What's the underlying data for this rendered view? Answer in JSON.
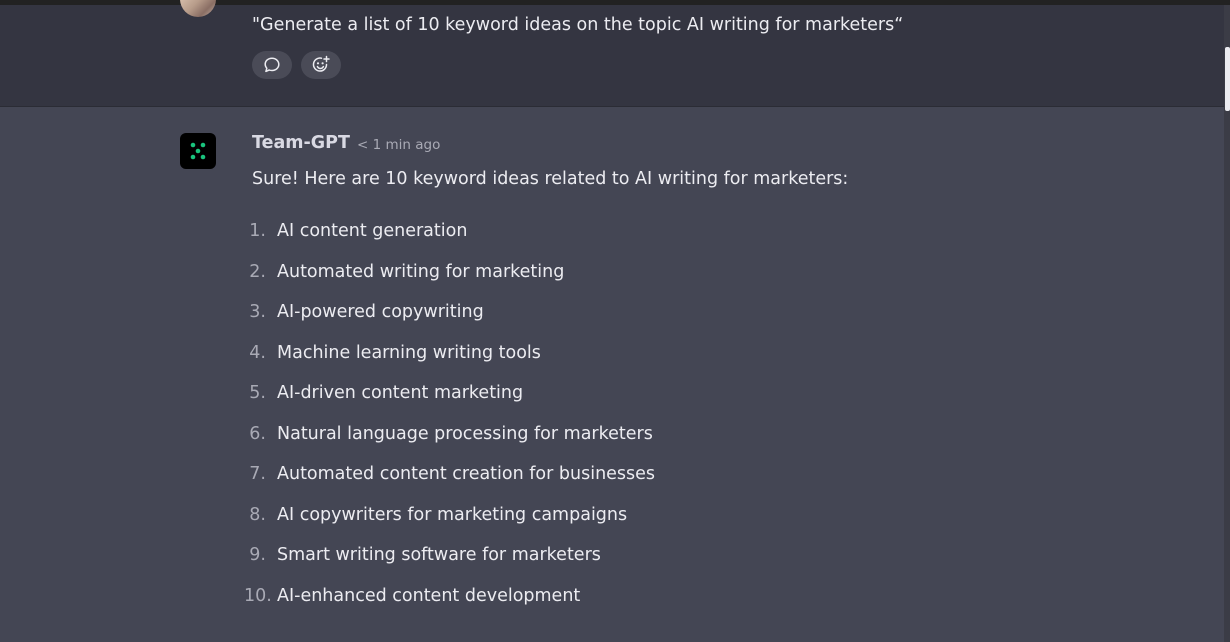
{
  "user_message": {
    "text": "\"Generate a list of 10 keyword ideas on the topic AI writing for marketers“",
    "actions": [
      {
        "icon": "comment-icon"
      },
      {
        "icon": "add-reaction-icon"
      }
    ]
  },
  "assistant_message": {
    "author": "Team-GPT",
    "timestamp": "< 1 min ago",
    "intro": "Sure! Here are 10 keyword ideas related to AI writing for marketers:",
    "keywords": [
      {
        "num": "1.",
        "text": "AI content generation"
      },
      {
        "num": "2.",
        "text": "Automated writing for marketing"
      },
      {
        "num": "3.",
        "text": "AI-powered copywriting"
      },
      {
        "num": "4.",
        "text": "Machine learning writing tools"
      },
      {
        "num": "5.",
        "text": "AI-driven content marketing"
      },
      {
        "num": "6.",
        "text": "Natural language processing for marketers"
      },
      {
        "num": "7.",
        "text": "Automated content creation for businesses"
      },
      {
        "num": "8.",
        "text": "AI copywriters for marketing campaigns"
      },
      {
        "num": "9.",
        "text": "Smart writing software for marketers"
      },
      {
        "num": "10.",
        "text": "AI-enhanced content development"
      }
    ]
  },
  "colors": {
    "user_bg": "#343541",
    "assistant_bg": "#444654",
    "logo_accent": "#19c37d"
  }
}
